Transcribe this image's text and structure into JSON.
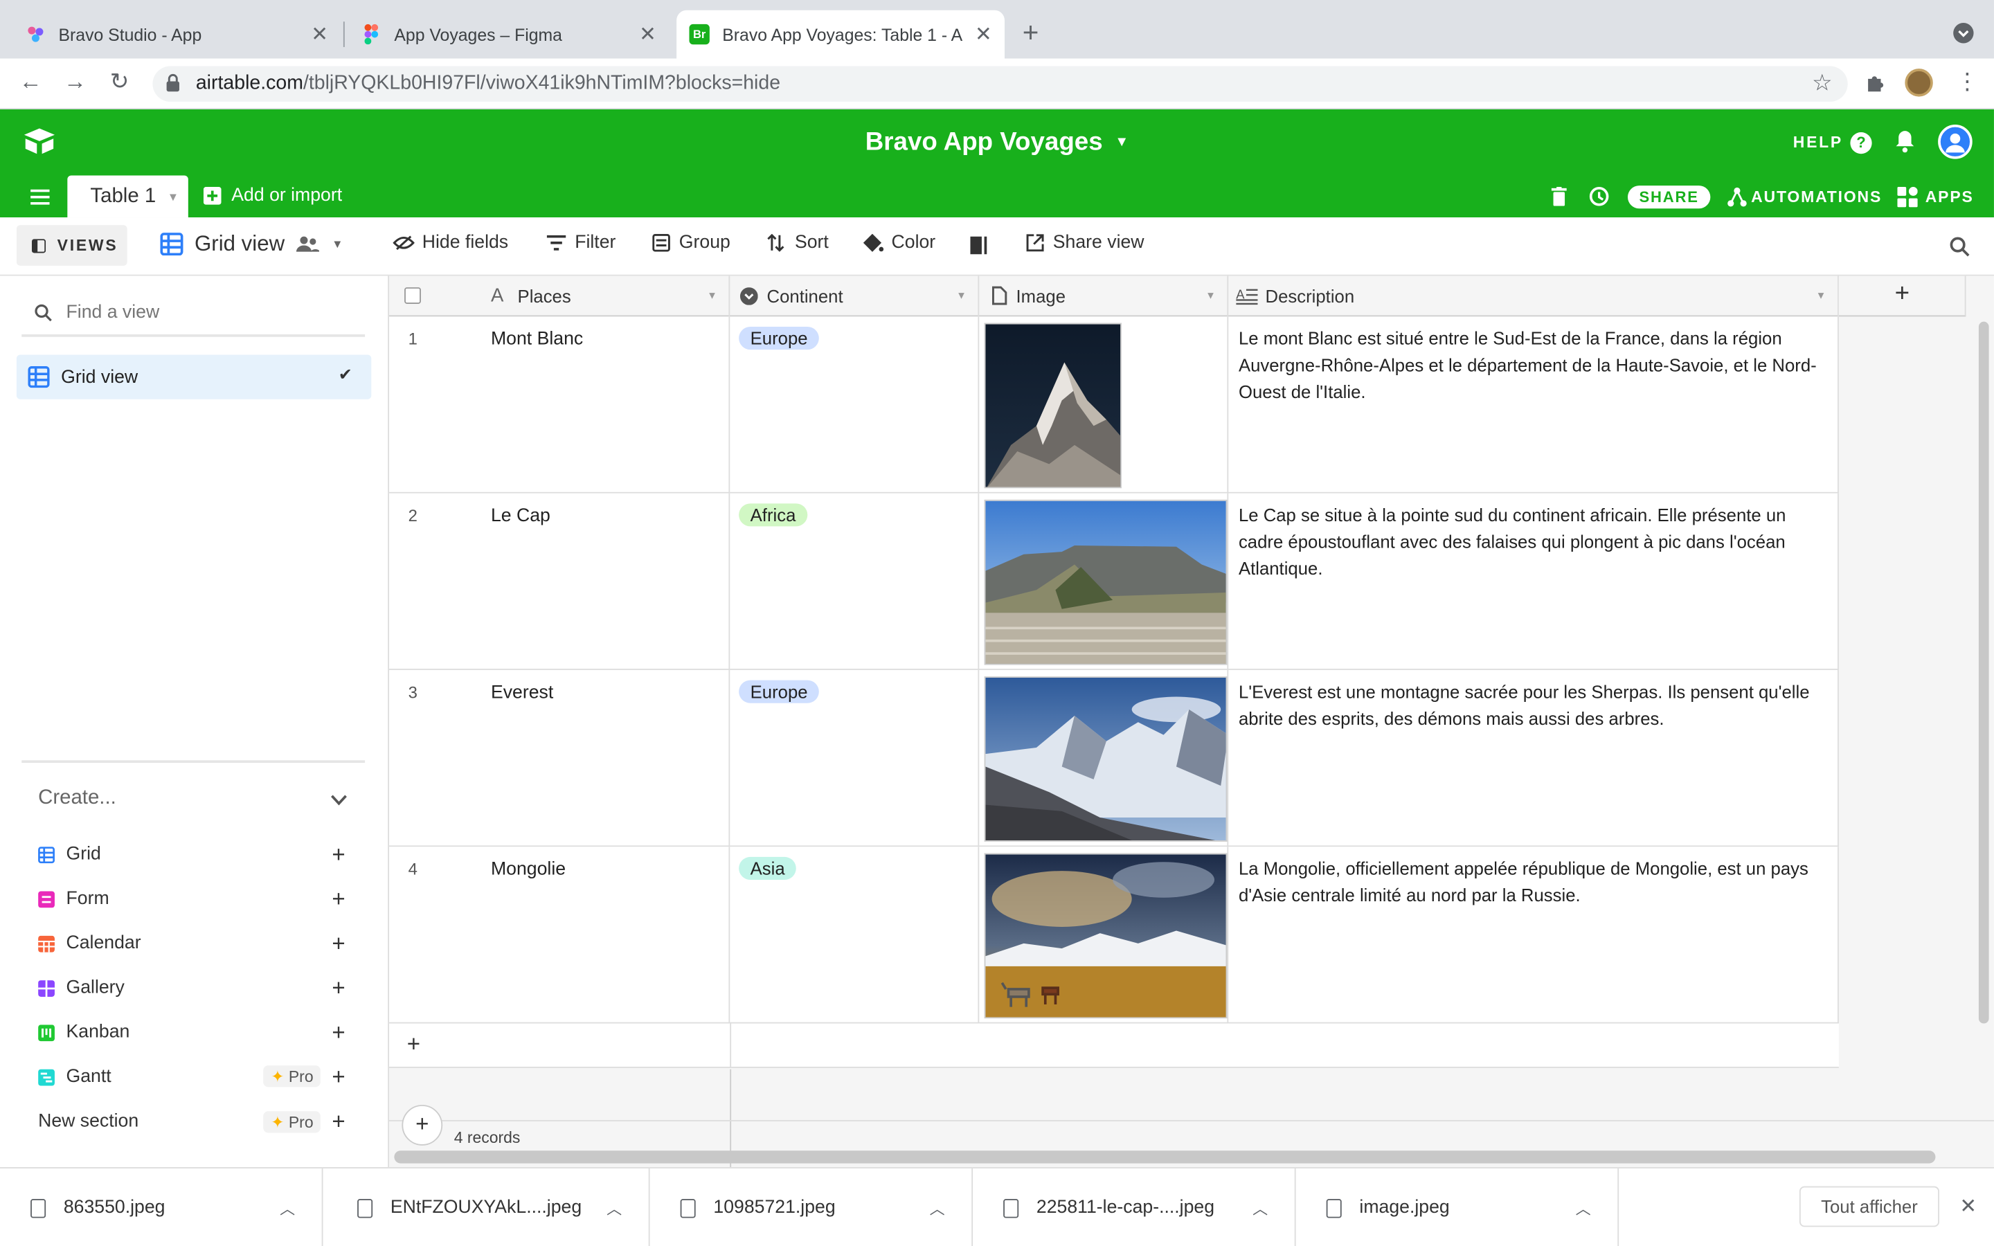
{
  "browser": {
    "tabs": [
      {
        "title": "Bravo Studio - App"
      },
      {
        "title": "App Voyages – Figma"
      },
      {
        "title": "Bravo App Voyages: Table 1 - A"
      }
    ],
    "url_domain": "airtable.com",
    "url_path": "/tbljRYQKLb0HI97Fl/viwoX41ik9hNTimIM?blocks=hide",
    "favicon_br": "Br"
  },
  "app": {
    "base_name": "Bravo App Voyages",
    "help": "HELP",
    "table_tab": "Table 1",
    "add_import": "Add or import",
    "share": "SHARE",
    "automations": "AUTOMATIONS",
    "apps": "APPS",
    "brand_color": "#18b01c"
  },
  "toolbar": {
    "views": "VIEWS",
    "view_name": "Grid view",
    "hide_fields": "Hide fields",
    "filter": "Filter",
    "group": "Group",
    "sort": "Sort",
    "color": "Color",
    "share_view": "Share view"
  },
  "sidebar": {
    "find_placeholder": "Find a view",
    "active_view": "Grid view",
    "create": "Create...",
    "items": [
      {
        "label": "Grid",
        "color": "#2d7ff9"
      },
      {
        "label": "Form",
        "color": "#e929ba"
      },
      {
        "label": "Calendar",
        "color": "#f7653b"
      },
      {
        "label": "Gallery",
        "color": "#8b46ff"
      },
      {
        "label": "Kanban",
        "color": "#20c933"
      },
      {
        "label": "Gantt",
        "color": "#20d9d2",
        "badge": "Pro"
      }
    ],
    "new_section": "New section",
    "new_section_badge": "Pro"
  },
  "grid": {
    "columns": [
      "Places",
      "Continent",
      "Image",
      "Description"
    ],
    "rows": [
      {
        "num": "1",
        "place": "Mont Blanc",
        "continent": "Europe",
        "continent_color": "#cfdfff",
        "description": "Le mont Blanc est situé entre le Sud-Est de la France, dans la région Auvergne-Rhône-Alpes et le département de la Haute-Savoie, et le Nord-Ouest de l'Italie."
      },
      {
        "num": "2",
        "place": "Le Cap",
        "continent": "Africa",
        "continent_color": "#d1f7c4",
        "description": "Le Cap se situe à la pointe sud du continent africain. Elle présente un cadre époustouflant avec des falaises qui plongent à pic dans l'océan Atlantique."
      },
      {
        "num": "3",
        "place": "Everest",
        "continent": "Europe",
        "continent_color": "#cfdfff",
        "description": "L'Everest est une montagne sacrée pour les Sherpas. Ils pensent qu'elle abrite des esprits, des démons mais aussi des arbres."
      },
      {
        "num": "4",
        "place": "Mongolie",
        "continent": "Asia",
        "continent_color": "#c2f5e9",
        "description": "La Mongolie, officiellement appelée république de Mongolie, est un pays d'Asie centrale limité au nord par la Russie."
      }
    ],
    "record_count": "4 records"
  },
  "downloads": {
    "files": [
      "863550.jpeg",
      "ENtFZOUXYAkL....jpeg",
      "10985721.jpeg",
      "225811-le-cap-....jpeg",
      "image.jpeg"
    ],
    "show_all": "Tout afficher"
  }
}
